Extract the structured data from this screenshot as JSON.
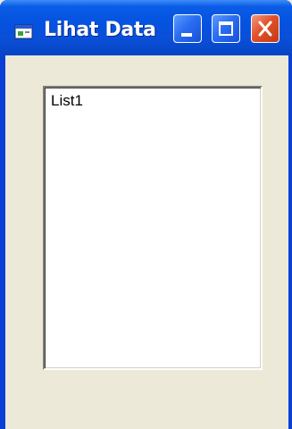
{
  "window": {
    "title": "Lihat Data",
    "accent_color": "#0a5ce6",
    "close_color": "#e2502a",
    "icon": "app-form-icon"
  },
  "titlebar_buttons": {
    "minimize": "minimize-icon",
    "maximize": "maximize-icon",
    "close": "close-icon"
  },
  "listbox": {
    "items": [
      "List1"
    ]
  }
}
